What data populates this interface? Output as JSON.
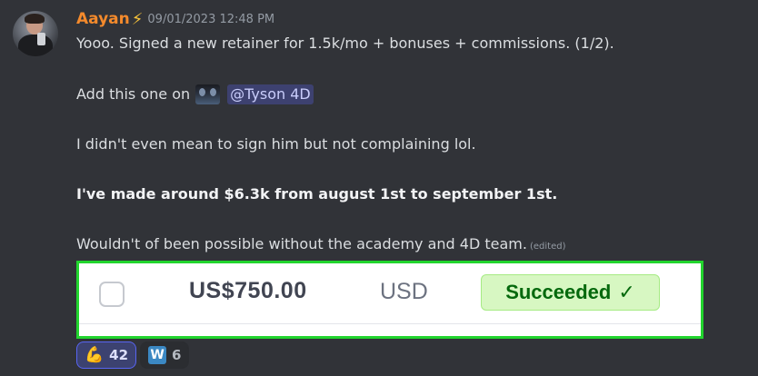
{
  "message": {
    "author": "Aayan",
    "author_badge": "⚡",
    "timestamp": "09/01/2023 12:48 PM",
    "lines": {
      "l1": "Yooo. Signed a new retainer for 1.5k/mo + bonuses + commissions. (1/2).",
      "l2_prefix": "Add this one on",
      "mention": "@Tyson 4D",
      "l3": "I didn't even mean to sign him but not complaining lol.",
      "l4": "I've made around $6.3k from august 1st to september 1st.",
      "l5": "Wouldn't of been possible without the academy and 4D team.",
      "edited": "(edited)"
    }
  },
  "payment": {
    "amount": "US$750.00",
    "currency": "USD",
    "status": "Succeeded",
    "status_icon": "✓"
  },
  "reactions": [
    {
      "emoji": "💪",
      "count": "42",
      "active": true
    },
    {
      "emoji": "W",
      "count": "6",
      "active": false
    }
  ],
  "colors": {
    "background": "#313338",
    "username": "#f48a2c",
    "mention_bg": "#5865f2",
    "highlight_border": "#22d52e",
    "status_green": "#05690d"
  }
}
